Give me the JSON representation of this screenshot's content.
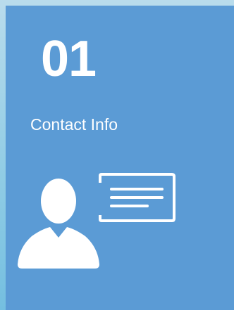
{
  "card": {
    "number": "01",
    "label": "Contact Info",
    "icon": "contact-card-icon",
    "background_color": "#5b9bd5",
    "text_color": "#ffffff"
  }
}
